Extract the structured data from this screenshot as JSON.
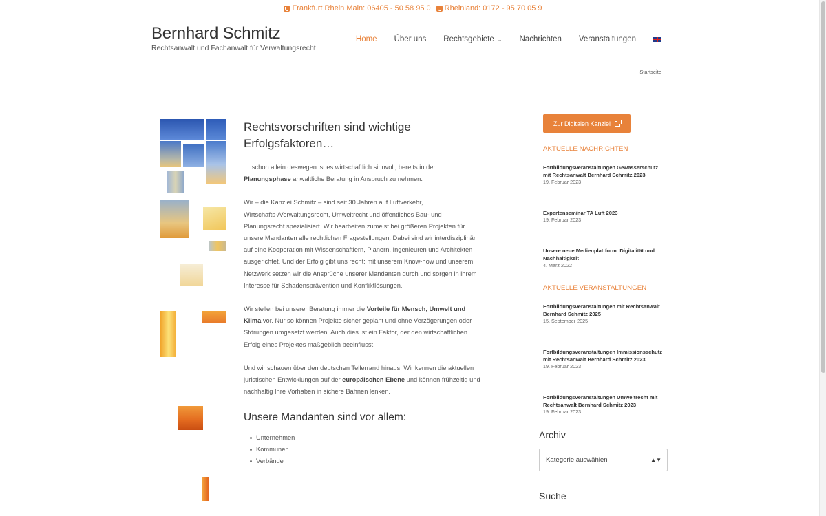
{
  "topbar": {
    "phone1": "Frankfurt Rhein Main: 06405 - 50 58 95 0",
    "phone2": "Rheinland: 0172 - 95 70 05 9"
  },
  "brand": {
    "title": "Bernhard Schmitz",
    "subtitle": "Rechtsanwalt und Fachanwalt für Verwaltungsrecht"
  },
  "nav": {
    "home": "Home",
    "about": "Über uns",
    "areas": "Rechtsgebiete",
    "news": "Nachrichten",
    "events": "Veranstaltungen",
    "language_icon": "uk-flag-icon"
  },
  "breadcrumb": "Startseite",
  "main": {
    "heading": "Rechtsvorschriften sind wichtige Erfolgsfaktoren…",
    "p1_a": "… schon allein deswegen ist es wirtschaftlich sinnvoll, bereits in der ",
    "p1_b": "Planungsphase",
    "p1_c": " anwaltliche Beratung in Anspruch zu nehmen.",
    "p2": "Wir – die Kanzlei Schmitz – sind seit 30 Jahren auf Luftverkehr, Wirtschafts-/Verwaltungsrecht, Umweltrecht und öffentliches Bau- und Planungsrecht spezialisiert. Wir bearbeiten zumeist bei größeren Projekten  für unsere Mandanten alle rechtlichen Fragestellungen. Dabei sind wir interdisziplinär auf eine Kooperation mit Wissenschaftlern, Planern, Ingenieuren und Architekten ausgerichtet. Und der Erfolg gibt uns recht: mit unserem Know-how und unserem Netzwerk setzen wir die Ansprüche unserer Mandanten durch und sorgen in ihrem Interesse für Schadensprävention und Konfliktlösungen.",
    "p3_a": "Wir stellen bei unserer Beratung immer die ",
    "p3_b": "Vorteile für Mensch, Umwelt und Klima",
    "p3_c": " vor. Nur so können Projekte sicher geplant und ohne Verzögerungen oder Störungen umgesetzt werden. Auch dies ist ein Faktor, der den wirtschaftlichen Erfolg eines Projektes maßgeblich beeinflusst.",
    "p4_a": "Und wir schauen über den deutschen Tellerrand hinaus. Wir kennen die aktuellen juristischen Entwicklungen auf der ",
    "p4_b": "europäischen Ebene",
    "p4_c": " und können frühzeitig und nachhaltig Ihre Vorhaben in sichere Bahnen lenken.",
    "clients_heading": "Unsere Mandanten sind vor allem:",
    "clients": [
      "Unternehmen",
      "Kommunen",
      "Verbände"
    ]
  },
  "sidebar": {
    "kanzlei_button": "Zur Digitalen Kanzlei",
    "news_heading": "AKTUELLE NACHRICHTEN",
    "news": [
      {
        "title": "Fortbildungsveranstaltungen Gewässerschutz mit Rechtsanwalt Bernhard Schmitz 2023",
        "date": "19. Februar 2023"
      },
      {
        "title": "Expertenseminar TA Luft 2023",
        "date": "19. Februar 2023"
      },
      {
        "title": "Unsere neue Medienplattform: Digitalität und Nachhaltigkeit",
        "date": "4. März 2022"
      }
    ],
    "events_heading": "AKTUELLE VERANSTALTUNGEN",
    "events": [
      {
        "title": "Fortbildungsveranstaltungen mit Rechtsanwalt Bernhard Schmitz 2025",
        "date": "15. September 2025"
      },
      {
        "title": "Fortbildungsveranstaltungen Immissionsschutz mit Rechtsanwalt Bernhard Schmitz 2023",
        "date": "19. Februar 2023"
      },
      {
        "title": "Fortbildungsveranstaltungen Umweltrecht mit Rechtsanwalt Bernhard Schmitz 2023",
        "date": "19. Februar 2023"
      }
    ],
    "archive_heading": "Archiv",
    "archive_select": "Kategorie auswählen",
    "search_heading": "Suche"
  },
  "colors": {
    "accent": "#e8823a",
    "text": "#444444"
  }
}
